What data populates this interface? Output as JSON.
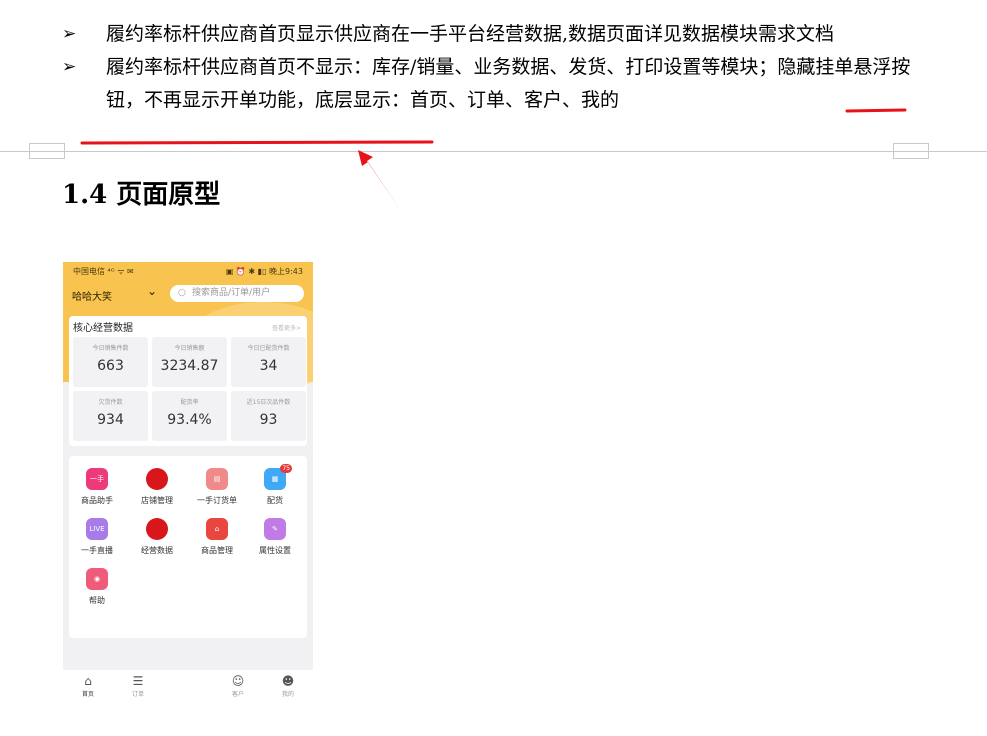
{
  "bullets": [
    {
      "marker": "➢",
      "text": "履约率标杆供应商首页显示供应商在一手平台经营数据,数据页面详见数据模块需求文档"
    },
    {
      "marker": "➢",
      "text_pre": "履约率标杆供应商首页不显示：库存/销量、业务数据、发货、打印设置等模块；",
      "text_hl": "隐藏挂单悬浮按钮，不再显示开单功能",
      "text_post": "，底层显示：首页、订单、客户、我的"
    }
  ],
  "heading": "1.4 页面原型",
  "annotation_color": "#e8121a",
  "phone": {
    "status_left": "中国电信 ⁴ᴳ ᯤ ✉",
    "status_right": "▣ ⏰ ✱ ▮▯ 晚上9:43",
    "store_name": "哈哈大笑",
    "search_placeholder": "搜索商品/订单/用户",
    "data_card": {
      "title": "核心经营数据",
      "more": "查看更多>",
      "stats": [
        {
          "label": "今日销售件数",
          "value": "663"
        },
        {
          "label": "今日销售额",
          "value": "3234.87"
        },
        {
          "label": "今日已配货件数",
          "value": "34"
        },
        {
          "label": "欠货件数",
          "value": "934"
        },
        {
          "label": "配货率",
          "value": "93.4%"
        },
        {
          "label": "近15日次品件数",
          "value": "93"
        }
      ]
    },
    "functions": [
      {
        "label": "商品助手",
        "icon": "yishou-icon",
        "color": "#ee3a7b",
        "glyph": "一手"
      },
      {
        "label": "店铺管理",
        "icon": "store-icon",
        "color": "#d9161c",
        "glyph": ""
      },
      {
        "label": "一手订货单",
        "icon": "order-sheet-icon",
        "color": "#f08a8a",
        "glyph": "▤"
      },
      {
        "label": "配货",
        "icon": "distribute-icon",
        "color": "#3fa9f5",
        "glyph": "▦",
        "badge": "75"
      },
      {
        "label": "一手直播",
        "icon": "live-icon",
        "color": "#a77be8",
        "glyph": "LIVE"
      },
      {
        "label": "经营数据",
        "icon": "business-data-icon",
        "color": "#d9161c",
        "glyph": ""
      },
      {
        "label": "商品管理",
        "icon": "goods-manage-icon",
        "color": "#e8463f",
        "glyph": "⌂"
      },
      {
        "label": "属性设置",
        "icon": "attribute-icon",
        "color": "#c07be6",
        "glyph": "✎"
      },
      {
        "label": "帮助",
        "icon": "help-icon",
        "color": "#ef5b7b",
        "glyph": "◉"
      }
    ],
    "tabs": [
      {
        "label": "首页",
        "icon": "home-icon",
        "glyph": "⌂",
        "active": true
      },
      {
        "label": "订单",
        "icon": "order-icon",
        "glyph": "☰"
      },
      {
        "label": "客户",
        "icon": "customer-icon",
        "glyph": "☺"
      },
      {
        "label": "我的",
        "icon": "mine-icon",
        "glyph": "☻"
      }
    ]
  }
}
